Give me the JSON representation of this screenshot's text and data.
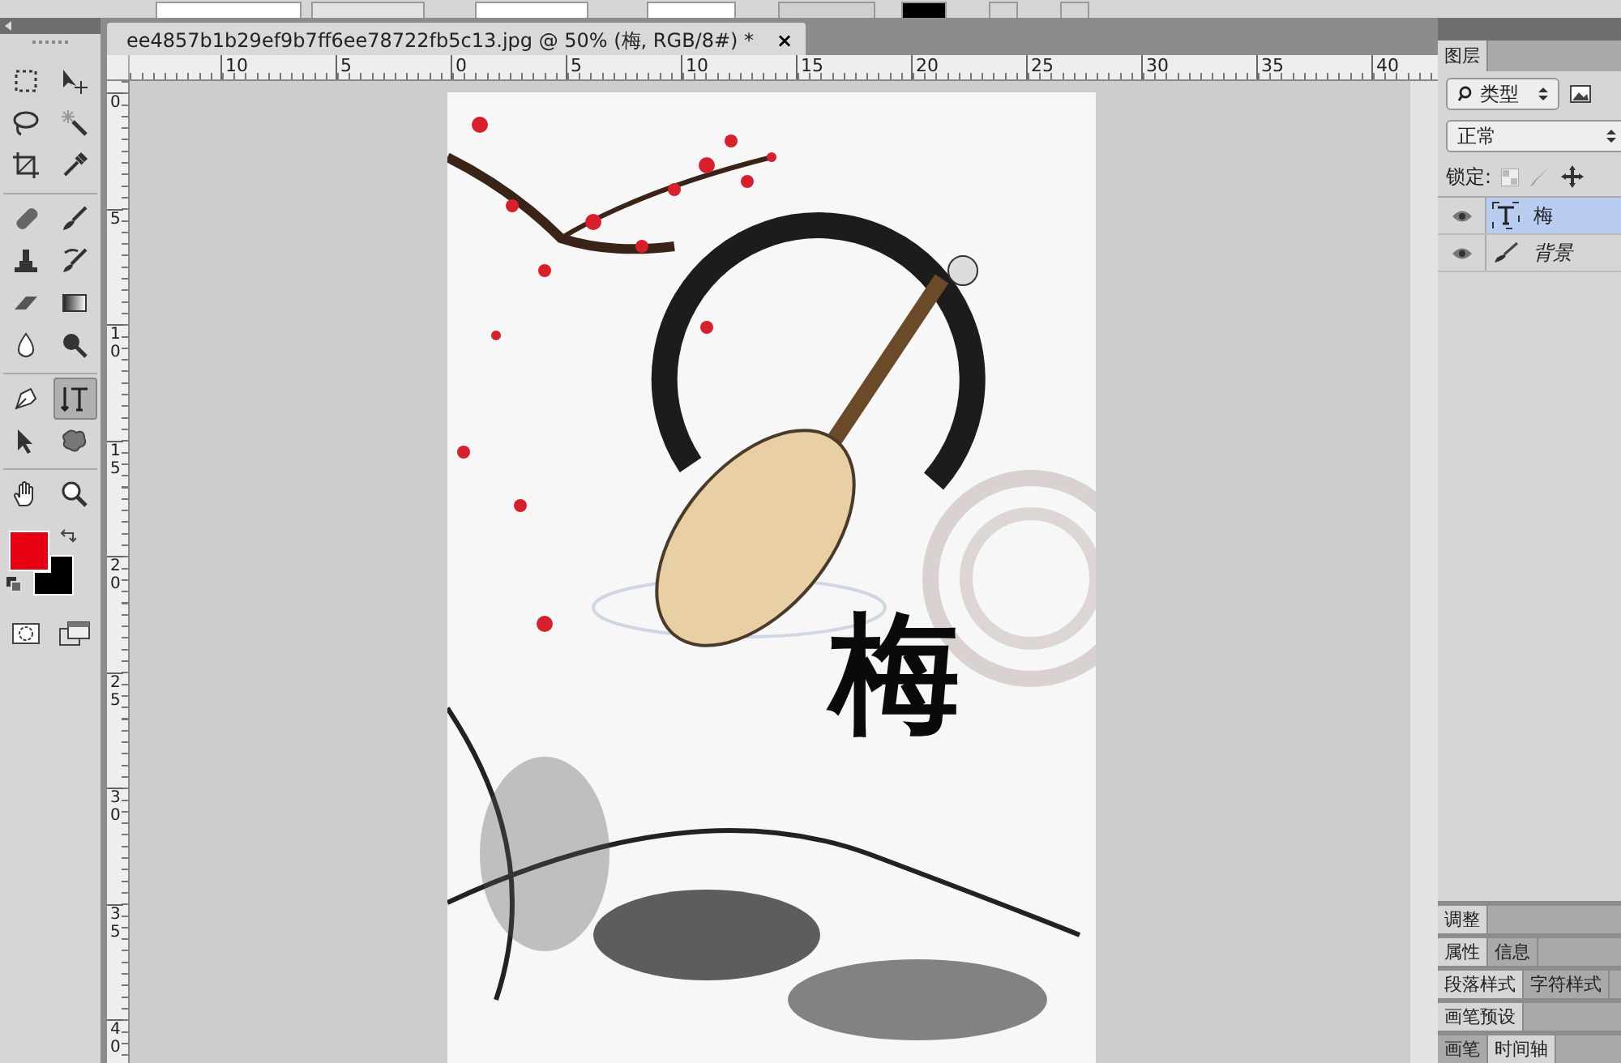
{
  "document_tab": {
    "title": "ee4857b1b29ef9b7ff6ee78722fb5c13.jpg @ 50% (梅, RGB/8#) *",
    "close": "×"
  },
  "ruler_h": [
    "10",
    "5",
    "0",
    "5",
    "10",
    "15",
    "20",
    "25",
    "30",
    "35",
    "40"
  ],
  "ruler_v": [
    "0",
    "5",
    "10",
    "15",
    "20",
    "25",
    "30",
    "35",
    "40"
  ],
  "tool_groups": [
    [
      {
        "kind": "marquee",
        "selected": false
      },
      {
        "kind": "move",
        "selected": false
      },
      {
        "kind": "lasso",
        "selected": false
      },
      {
        "kind": "wand",
        "selected": false
      },
      {
        "kind": "crop",
        "selected": false
      },
      {
        "kind": "eyedropper",
        "selected": false
      }
    ],
    [
      {
        "kind": "bandage",
        "selected": false
      },
      {
        "kind": "brush",
        "selected": false
      },
      {
        "kind": "stamp",
        "selected": false
      },
      {
        "kind": "history",
        "selected": false
      },
      {
        "kind": "eraser",
        "selected": false
      },
      {
        "kind": "gradient",
        "selected": false
      },
      {
        "kind": "drop",
        "selected": false
      },
      {
        "kind": "dodge",
        "selected": false
      }
    ],
    [
      {
        "kind": "pen",
        "selected": false
      },
      {
        "kind": "type",
        "selected": true
      },
      {
        "kind": "select",
        "selected": false
      },
      {
        "kind": "shape",
        "selected": false
      }
    ],
    [
      {
        "kind": "hand",
        "selected": false
      },
      {
        "kind": "zoom",
        "selected": false
      }
    ]
  ],
  "swatches": [
    {
      "kind": "foreground",
      "color": "#e60012"
    },
    {
      "kind": "background",
      "color": "#000000"
    }
  ],
  "canvas": {
    "text_layer": "梅"
  },
  "layers_panel": {
    "tab": "图层",
    "filter": "类型",
    "blend_mode": "正常",
    "lock_label": "锁定:",
    "layers": [
      {
        "name": "梅",
        "kind": "text",
        "visible": true,
        "selected": true
      },
      {
        "name": "背景",
        "kind": "paint",
        "visible": true,
        "selected": false
      }
    ]
  },
  "panel_groups": [
    {
      "tabs": [
        {
          "label": "调整",
          "selected": true
        }
      ]
    },
    {
      "tabs": [
        {
          "label": "属性",
          "selected": true
        },
        {
          "label": "信息",
          "selected": false
        }
      ]
    },
    {
      "tabs": [
        {
          "label": "段落样式",
          "selected": true
        },
        {
          "label": "字符样式",
          "selected": false
        }
      ]
    },
    {
      "tabs": [
        {
          "label": "画笔预设",
          "selected": true
        }
      ]
    },
    {
      "tabs": [
        {
          "label": "画笔",
          "selected": false
        },
        {
          "label": "时间轴",
          "selected": true
        }
      ]
    }
  ]
}
